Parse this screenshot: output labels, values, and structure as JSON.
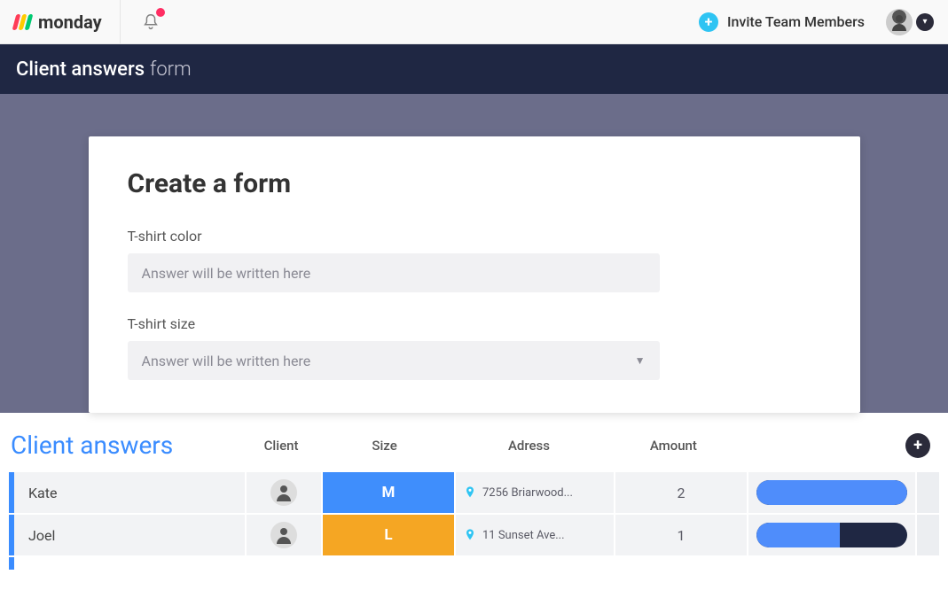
{
  "brand": "monday",
  "header": {
    "invite_label": "Invite Team Members"
  },
  "titlebar": {
    "prefix": "Client answers",
    "suffix": "form"
  },
  "form": {
    "title": "Create a form",
    "fields": [
      {
        "label": "T-shirt color",
        "placeholder": "Answer will be written here",
        "type": "text"
      },
      {
        "label": "T-shirt size",
        "placeholder": "Answer will be written here",
        "type": "select"
      }
    ]
  },
  "board": {
    "title": "Client answers",
    "columns": {
      "client": "Client",
      "size": "Size",
      "adress": "Adress",
      "amount": "Amount"
    },
    "rows": [
      {
        "name": "Kate",
        "size": "M",
        "size_color": "blue",
        "address": "7256 Briarwood...",
        "amount": "2",
        "progress_pct": 100
      },
      {
        "name": "Joel",
        "size": "L",
        "size_color": "orange",
        "address": "11 Sunset Ave...",
        "amount": "1",
        "progress_pct": 55
      }
    ]
  },
  "colors": {
    "accent_blue": "#3f8efc",
    "accent_orange": "#f5a623",
    "board_title": "#3a8cff",
    "dark_bar": "#1f2743",
    "canvas": "#6b6d8a"
  }
}
